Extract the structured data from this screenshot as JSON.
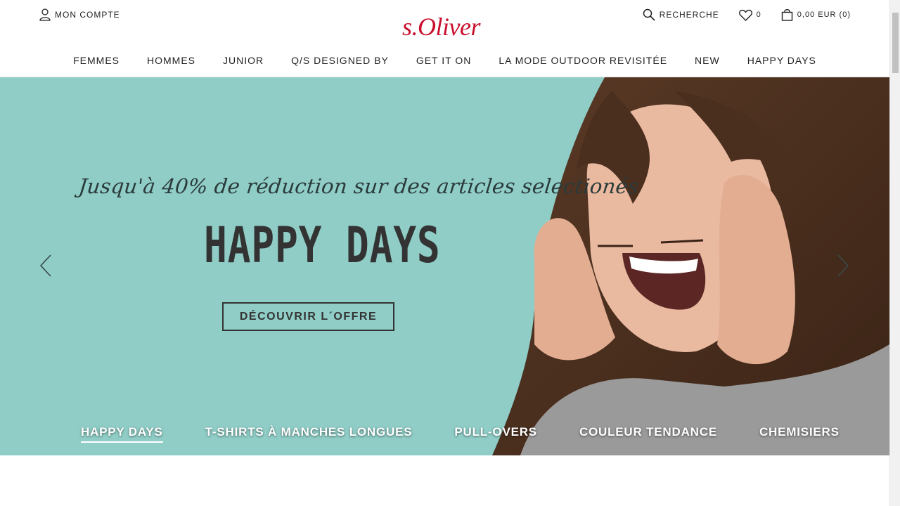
{
  "header": {
    "account_label": "MON COMPTE",
    "logo": "s.Oliver",
    "search_label": "RECHERCHE",
    "wishlist_count": "0",
    "cart_label": "0,00 EUR (0)"
  },
  "nav": {
    "items": [
      {
        "label": "FEMMES"
      },
      {
        "label": "HOMMES"
      },
      {
        "label": "JUNIOR"
      },
      {
        "label": "Q/S DESIGNED BY"
      },
      {
        "label": "GET IT ON"
      },
      {
        "label": "LA MODE OUTDOOR REVISITÉE"
      },
      {
        "label": "NEW"
      },
      {
        "label": "HAPPY DAYS"
      }
    ]
  },
  "hero": {
    "tagline": "Jusqu'à 40% de réduction sur des articles selectionés",
    "headline": "HAPPY DAYS",
    "cta_label": "DÉCOUVRIR L´OFFRE",
    "links": [
      {
        "label": "HAPPY DAYS",
        "active": true
      },
      {
        "label": "T-SHIRTS À MANCHES LONGUES",
        "active": false
      },
      {
        "label": "PULL-OVERS",
        "active": false
      },
      {
        "label": "COULEUR TENDANCE",
        "active": false
      },
      {
        "label": "CHEMISIERS",
        "active": false
      }
    ]
  },
  "colors": {
    "brand": "#c8102e",
    "hero_background": "#8fcdc6",
    "text_dark": "#333333"
  },
  "icons": {
    "account": "user-icon",
    "search": "search-icon",
    "wishlist": "heart-icon",
    "cart": "shopping-bag-icon",
    "prev": "chevron-left-icon",
    "next": "chevron-right-icon"
  }
}
